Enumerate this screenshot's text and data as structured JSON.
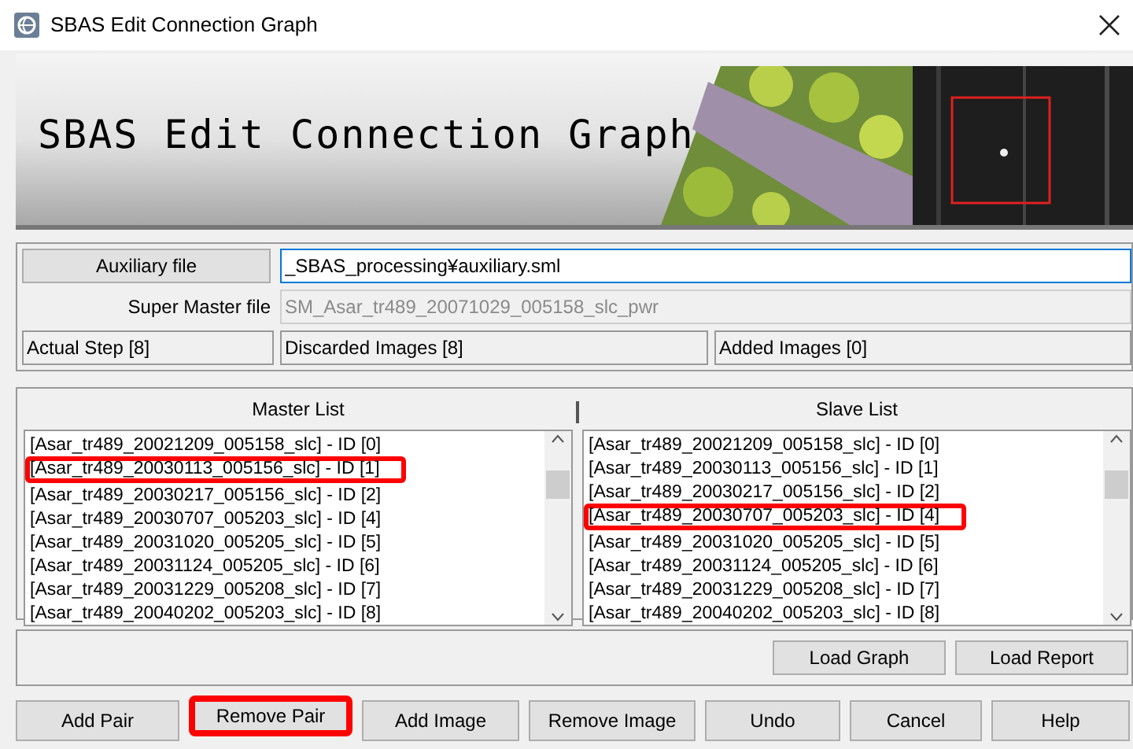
{
  "window": {
    "title": "SBAS Edit Connection Graph"
  },
  "banner": {
    "title": "SBAS Edit Connection Graph"
  },
  "auxiliary_file": {
    "label": "Auxiliary file",
    "value": "_SBAS_processing¥auxiliary.sml"
  },
  "super_master_file": {
    "label": "Super Master file",
    "value": "SM_Asar_tr489_20071029_005158_slc_pwr",
    "disabled": true
  },
  "status": [
    "Actual Step [8]",
    "Discarded Images [8]",
    "Added Images [0]"
  ],
  "master_list": {
    "title": "Master List",
    "items": [
      {
        "text": "[Asar_tr489_20021209_005158_slc] - ID [0]",
        "highlighted": false
      },
      {
        "text": "[Asar_tr489_20030113_005156_slc] - ID [1]",
        "highlighted": true
      },
      {
        "text": "[Asar_tr489_20030217_005156_slc] - ID [2]",
        "highlighted": false
      },
      {
        "text": "[Asar_tr489_20030707_005203_slc] - ID [4]",
        "highlighted": false
      },
      {
        "text": "[Asar_tr489_20031020_005205_slc] - ID [5]",
        "highlighted": false
      },
      {
        "text": "[Asar_tr489_20031124_005205_slc] - ID [6]",
        "highlighted": false
      },
      {
        "text": "[Asar_tr489_20031229_005208_slc] - ID [7]",
        "highlighted": false
      },
      {
        "text": "[Asar_tr489_20040202_005203_slc] - ID [8]",
        "highlighted": false
      }
    ]
  },
  "slave_list": {
    "title": "Slave List",
    "items": [
      {
        "text": "[Asar_tr489_20021209_005158_slc] - ID [0]",
        "highlighted": false
      },
      {
        "text": "[Asar_tr489_20030113_005156_slc] - ID [1]",
        "highlighted": false
      },
      {
        "text": "[Asar_tr489_20030217_005156_slc] - ID [2]",
        "highlighted": false
      },
      {
        "text": "[Asar_tr489_20030707_005203_slc] - ID [4]",
        "highlighted": true
      },
      {
        "text": "[Asar_tr489_20031020_005205_slc] - ID [5]",
        "highlighted": false
      },
      {
        "text": "[Asar_tr489_20031124_005205_slc] - ID [6]",
        "highlighted": false
      },
      {
        "text": "[Asar_tr489_20031229_005208_slc] - ID [7]",
        "highlighted": false
      },
      {
        "text": "[Asar_tr489_20040202_005203_slc] - ID [8]",
        "highlighted": false
      }
    ]
  },
  "load_buttons": [
    "Load Graph",
    "Load Report"
  ],
  "buttons": [
    {
      "label": "Add Pair",
      "highlighted": false
    },
    {
      "label": "Remove Pair",
      "highlighted": true
    },
    {
      "label": "Add Image",
      "highlighted": false
    },
    {
      "label": "Remove Image",
      "highlighted": false
    },
    {
      "label": "Undo",
      "highlighted": false
    },
    {
      "label": "Cancel",
      "highlighted": false
    },
    {
      "label": "Help",
      "highlighted": false
    }
  ]
}
